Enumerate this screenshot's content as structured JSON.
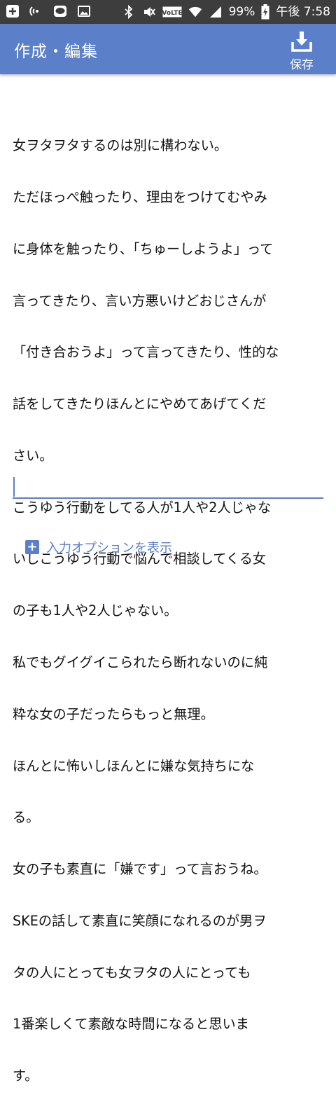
{
  "status_bar": {
    "battery_percent": "99%",
    "time": "午後 7:58",
    "volte_label": "VoLTE",
    "icons": [
      "add-icon",
      "nfc-icon",
      "line-app-icon",
      "gallery-icon",
      "bluetooth-icon",
      "mute-icon",
      "volte-icon",
      "wifi-icon",
      "signal-icon",
      "battery-charging-icon"
    ]
  },
  "app_bar": {
    "title": "作成・編集",
    "save_label": "保存",
    "color": "#5b7fc9"
  },
  "editor": {
    "lines": [
      "女ヲタヲタするのは別に構わない。",
      "ただほっぺ触ったり、理由をつけてむやみ",
      "に身体を触ったり、「ちゅーしようよ」って",
      "言ってきたり、言い方悪いけどおじさんが",
      "「付き合おうよ」って言ってきたり、性的な",
      "話をしてきたりほんとにやめてあげてくだ",
      "さい。",
      "こうゆう行動をしてる人が1人や2人じゃな",
      "いしこうゆう行動で悩んで相談してくる女",
      "の子も1人や2人じゃない。",
      "私でもグイグイこられたら断れないのに純",
      "粋な女の子だったらもっと無理。",
      "ほんとに怖いしほんとに嫌な気持ちにな",
      "る。",
      "女の子も素直に「嫌です」って言おうね。",
      "SKEの話して素直に笑顔になれるのが男ヲ",
      "タの人にとっても女ヲタの人にとっても",
      "1番楽しくて素敵な時間になると思いま",
      "す。"
    ]
  },
  "footer": {
    "input_options_label": "入力オプションを表示"
  }
}
